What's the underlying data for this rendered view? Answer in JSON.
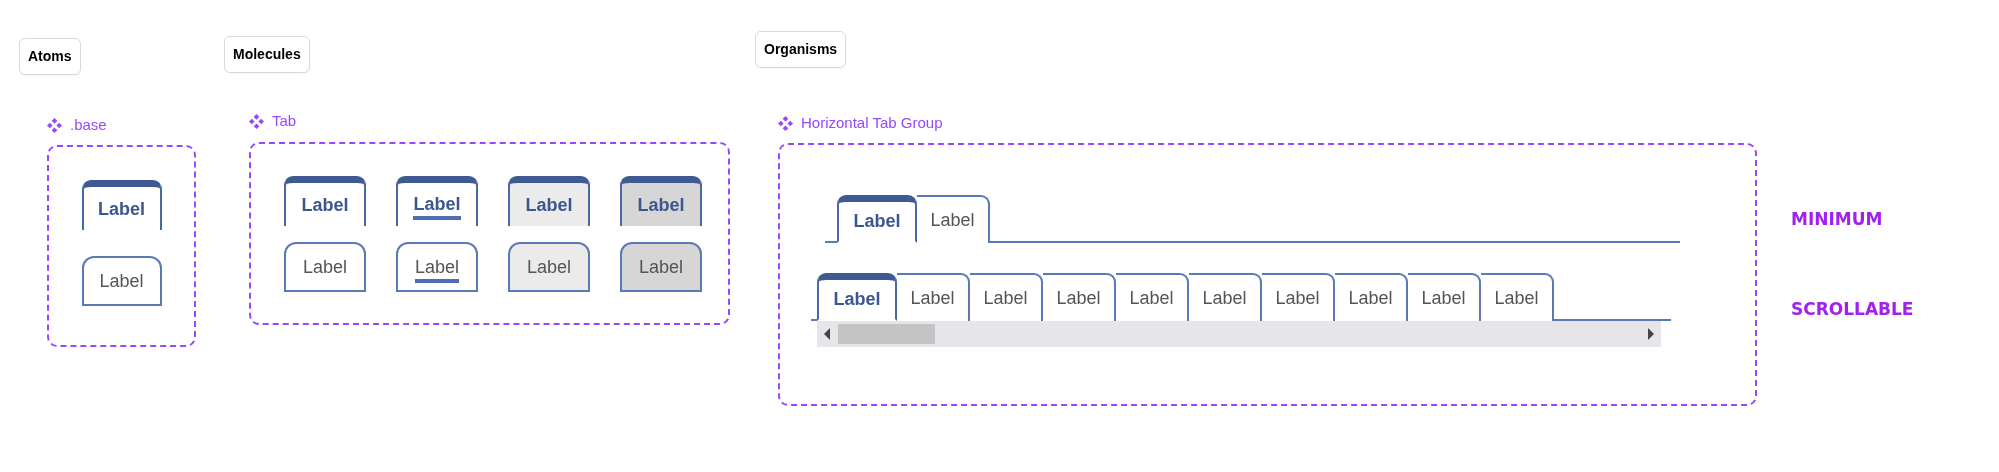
{
  "sections": [
    {
      "label": "Atoms"
    },
    {
      "label": "Molecules"
    },
    {
      "label": "Organisms"
    }
  ],
  "atoms": {
    "component": ".base",
    "tabs": [
      {
        "label": "Label",
        "selected": true
      },
      {
        "label": "Label",
        "selected": false
      }
    ]
  },
  "molecules": {
    "component": "Tab",
    "tabs": [
      {
        "label": "Label",
        "selected": true,
        "kind": "rest"
      },
      {
        "label": "Label",
        "selected": true,
        "kind": "focused"
      },
      {
        "label": "Label",
        "selected": true,
        "kind": "hovered"
      },
      {
        "label": "Label",
        "selected": true,
        "kind": "pressed"
      },
      {
        "label": "Label",
        "selected": false,
        "kind": "rest"
      },
      {
        "label": "Label",
        "selected": false,
        "kind": "focused"
      },
      {
        "label": "Label",
        "selected": false,
        "kind": "hovered"
      },
      {
        "label": "Label",
        "selected": false,
        "kind": "pressed"
      }
    ]
  },
  "organisms": {
    "component": "Horizontal Tab Group",
    "groups": [
      {
        "variant_label": "MINIMUM",
        "kind": "minimum",
        "tabs": [
          {
            "label": "Label",
            "selected": true
          },
          {
            "label": "Label",
            "selected": false
          }
        ]
      },
      {
        "variant_label": "SCROLLABLE",
        "kind": "scrollable",
        "tabs": [
          {
            "label": "Label",
            "selected": true
          },
          {
            "label": "Label",
            "selected": false
          },
          {
            "label": "Label",
            "selected": false
          },
          {
            "label": "Label",
            "selected": false
          },
          {
            "label": "Label",
            "selected": false
          },
          {
            "label": "Label",
            "selected": false
          },
          {
            "label": "Label",
            "selected": false
          },
          {
            "label": "Label",
            "selected": false
          },
          {
            "label": "Label",
            "selected": false
          },
          {
            "label": "Label",
            "selected": false
          }
        ]
      }
    ]
  }
}
